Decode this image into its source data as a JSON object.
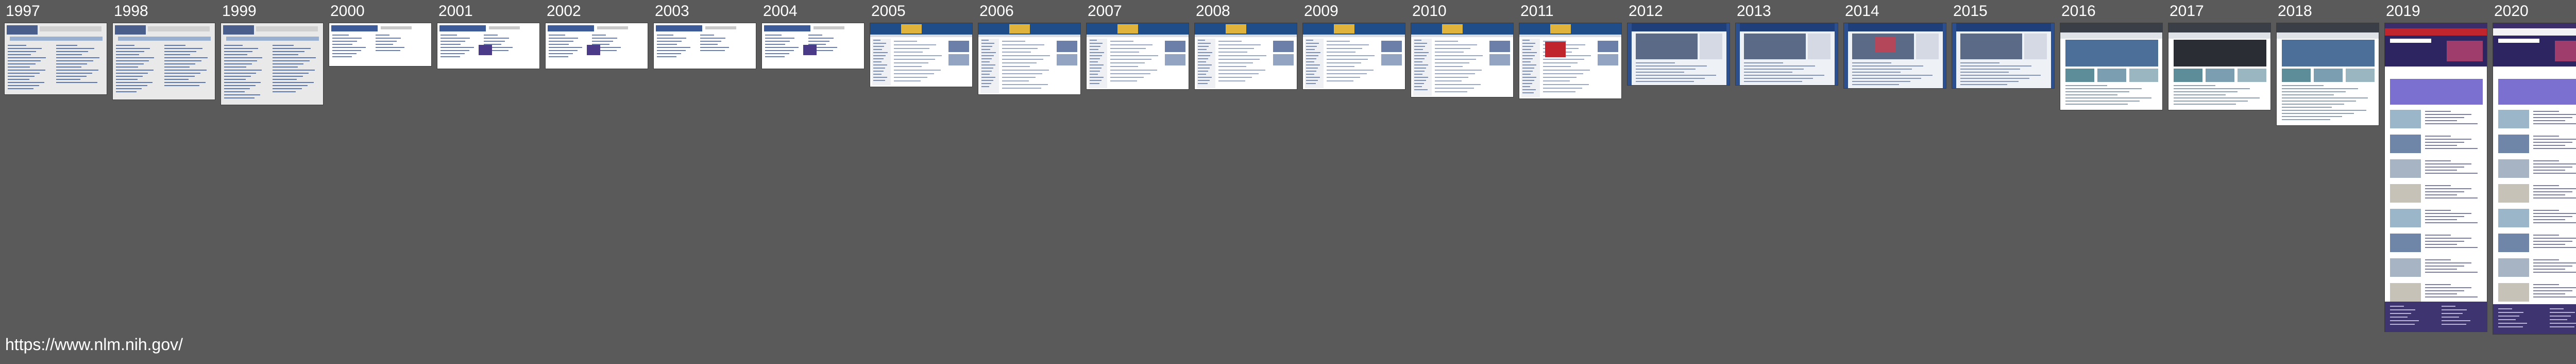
{
  "site_url": "https://www.nlm.nih.gov/",
  "colors": {
    "background": "#5a5a5a",
    "label": "#ffffff",
    "nih_blue": "#1f4d8a",
    "nlm_purple": "#4b3a87",
    "nlm_red": "#c0242d"
  },
  "snapshots": [
    {
      "year": "1997",
      "style": "gray-text"
    },
    {
      "year": "1998",
      "style": "gray-text"
    },
    {
      "year": "1999",
      "style": "gray-text"
    },
    {
      "year": "2000",
      "style": "white-short"
    },
    {
      "year": "2001",
      "style": "white-short"
    },
    {
      "year": "2002",
      "style": "white-short"
    },
    {
      "year": "2003",
      "style": "white-short"
    },
    {
      "year": "2004",
      "style": "white-short"
    },
    {
      "year": "2005",
      "style": "blue-header"
    },
    {
      "year": "2006",
      "style": "blue-header"
    },
    {
      "year": "2007",
      "style": "blue-header"
    },
    {
      "year": "2008",
      "style": "blue-header"
    },
    {
      "year": "2009",
      "style": "blue-header"
    },
    {
      "year": "2010",
      "style": "blue-header"
    },
    {
      "year": "2011",
      "style": "blue-header"
    },
    {
      "year": "2012",
      "style": "blue-bg"
    },
    {
      "year": "2013",
      "style": "blue-bg"
    },
    {
      "year": "2014",
      "style": "blue-bg"
    },
    {
      "year": "2015",
      "style": "blue-bg"
    },
    {
      "year": "2016",
      "style": "gray-modern"
    },
    {
      "year": "2017",
      "style": "gray-modern"
    },
    {
      "year": "2018",
      "style": "gray-modern"
    },
    {
      "year": "2019",
      "style": "purple-long"
    },
    {
      "year": "2020",
      "style": "purple-long"
    }
  ]
}
